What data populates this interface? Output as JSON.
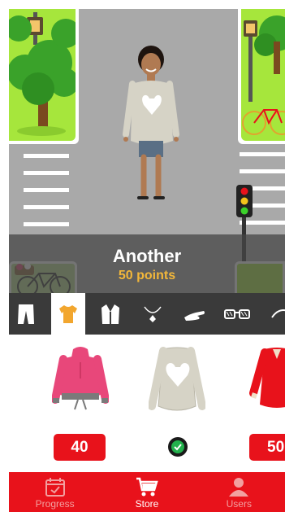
{
  "preview": {
    "item_name": "Another",
    "item_points": "50 points"
  },
  "categories": [
    {
      "id": "pants",
      "icon": "pants-icon",
      "active": false
    },
    {
      "id": "shirt",
      "icon": "shirt-icon",
      "active": true
    },
    {
      "id": "jacket",
      "icon": "jacket-icon",
      "active": false
    },
    {
      "id": "necklace",
      "icon": "necklace-icon",
      "active": false
    },
    {
      "id": "bracelet",
      "icon": "bracelet-icon",
      "active": false
    },
    {
      "id": "glasses",
      "icon": "glasses-icon",
      "active": false
    },
    {
      "id": "earrings",
      "icon": "earring-icon",
      "active": false
    }
  ],
  "items": [
    {
      "name": "pink hoodie",
      "price": "40",
      "owned": false,
      "color": "#e8477a"
    },
    {
      "name": "grey heart sweater",
      "price": "",
      "owned": true,
      "color": "#d6d3c6"
    },
    {
      "name": "red dress",
      "price": "50",
      "owned": false,
      "color": "#e8121b"
    }
  ],
  "tabs": [
    {
      "label": "Progress",
      "icon": "calendar-check-icon",
      "active": false
    },
    {
      "label": "Store",
      "icon": "cart-icon",
      "active": true
    },
    {
      "label": "Users",
      "icon": "user-icon",
      "active": false
    }
  ],
  "colors": {
    "accent": "#e8121b",
    "points": "#f2b73a",
    "category_bar": "#3a3a3a",
    "road": "#a9a9a9",
    "grass": "#a6e63c"
  }
}
